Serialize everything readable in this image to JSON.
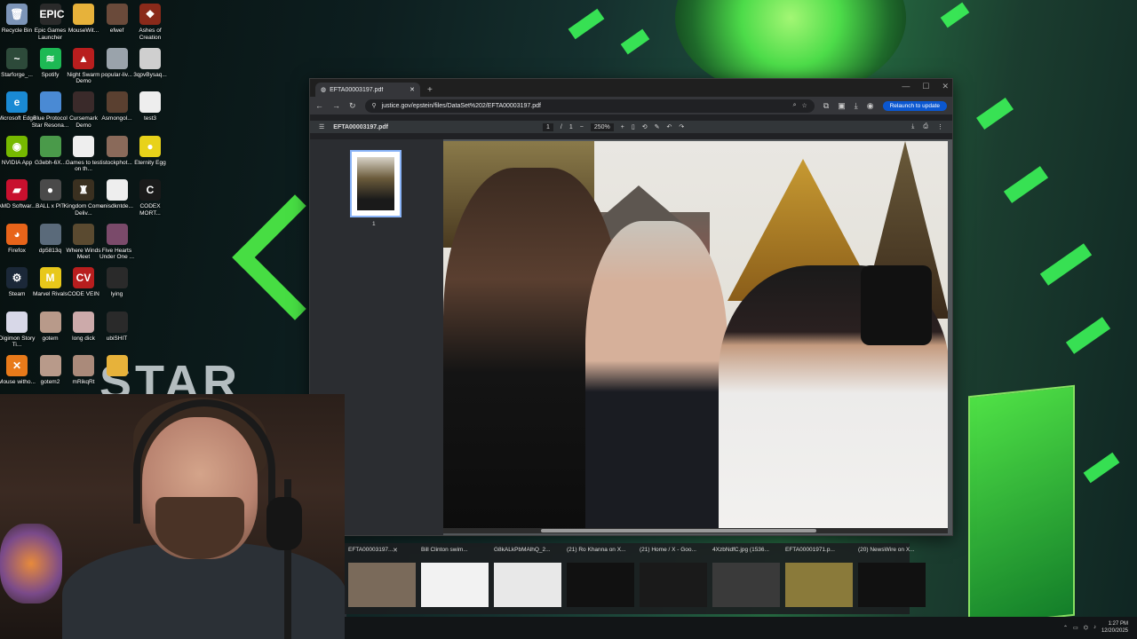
{
  "desktop": {
    "icons": [
      {
        "label": "Recycle Bin",
        "icon": "recycle-bin-icon",
        "color": "#7c95b8",
        "glyph": "🗑"
      },
      {
        "label": "Epic Games Launcher",
        "icon": "epic-games-icon",
        "color": "#2a2a2a",
        "glyph": "EPIC"
      },
      {
        "label": "MouseWit...",
        "icon": "folder-icon",
        "color": "#e7b23a",
        "glyph": ""
      },
      {
        "label": "efwef",
        "icon": "portrait-icon",
        "color": "#6a4a3a",
        "glyph": ""
      },
      {
        "label": "Ashes of Creation",
        "icon": "ashes-icon",
        "color": "#8a2a1a",
        "glyph": "❖"
      },
      {
        "label": "Starforge_...",
        "icon": "starforge-icon",
        "color": "#2d4a3a",
        "glyph": "~"
      },
      {
        "label": "Spotify",
        "icon": "spotify-icon",
        "color": "#1db954",
        "glyph": "≋"
      },
      {
        "label": "Night Swarm Demo",
        "icon": "night-swarm-icon",
        "color": "#b81e1e",
        "glyph": "▲"
      },
      {
        "label": "popular-liv...",
        "icon": "image-file-icon",
        "color": "#9aa3ab",
        "glyph": ""
      },
      {
        "label": "3qpvBysaq...",
        "icon": "image-file-icon",
        "color": "#cfcfcf",
        "glyph": ""
      },
      {
        "label": "Microsoft Edge",
        "icon": "edge-icon",
        "color": "#1a8ad4",
        "glyph": "e"
      },
      {
        "label": "Blue Protocol Star Resona...",
        "icon": "blue-protocol-icon",
        "color": "#4a8ad4",
        "glyph": ""
      },
      {
        "label": "Cursemark Demo",
        "icon": "cursemark-icon",
        "color": "#3a2a2a",
        "glyph": ""
      },
      {
        "label": "Asmongol...",
        "icon": "portrait-icon",
        "color": "#5a4030",
        "glyph": ""
      },
      {
        "label": "test3",
        "icon": "text-file-icon",
        "color": "#eeeeee",
        "glyph": ""
      },
      {
        "label": "NVIDIA App",
        "icon": "nvidia-icon",
        "color": "#76b900",
        "glyph": "◉"
      },
      {
        "label": "G3ebh-6X...",
        "icon": "image-file-icon",
        "color": "#4a9a4a",
        "glyph": ""
      },
      {
        "label": "Games to test on th...",
        "icon": "text-file-icon",
        "color": "#eeeeee",
        "glyph": ""
      },
      {
        "label": "istockphot...",
        "icon": "image-file-icon",
        "color": "#8a6a5a",
        "glyph": ""
      },
      {
        "label": "Eternity Egg",
        "icon": "eternity-egg-icon",
        "color": "#e8d21a",
        "glyph": "●"
      },
      {
        "label": "AMD Softwar...",
        "icon": "amd-icon",
        "color": "#c8102e",
        "glyph": "▰"
      },
      {
        "label": "BALL x PIT",
        "icon": "ball-pit-icon",
        "color": "#4a4a4a",
        "glyph": "●"
      },
      {
        "label": "Kingdom Come Deliv...",
        "icon": "kingdom-come-icon",
        "color": "#3a3020",
        "glyph": "♜"
      },
      {
        "label": "unisdkntde...",
        "icon": "text-file-icon",
        "color": "#eeeeee",
        "glyph": ""
      },
      {
        "label": "CODEX MORT...",
        "icon": "codex-icon",
        "color": "#1a1a1a",
        "glyph": "C"
      },
      {
        "label": "Firefox",
        "icon": "firefox-icon",
        "color": "#e8641a",
        "glyph": "◕"
      },
      {
        "label": "dp5813q",
        "icon": "image-file-icon",
        "color": "#5a6a7a",
        "glyph": ""
      },
      {
        "label": "Where Winds Meet",
        "icon": "where-winds-icon",
        "color": "#5a4a30",
        "glyph": ""
      },
      {
        "label": "Five Hearts Under One ...",
        "icon": "five-hearts-icon",
        "color": "#7a4a6a",
        "glyph": ""
      },
      {
        "label": "",
        "icon": "blank-icon",
        "color": "transparent",
        "glyph": ""
      },
      {
        "label": "Steam",
        "icon": "steam-icon",
        "color": "#1b2838",
        "glyph": "⚙"
      },
      {
        "label": "Marvel Rivals",
        "icon": "marvel-rivals-icon",
        "color": "#e8c81a",
        "glyph": "M"
      },
      {
        "label": "CODE VEIN",
        "icon": "code-vein-icon",
        "color": "#b81e1e",
        "glyph": "CV"
      },
      {
        "label": "lying",
        "icon": "image-file-icon",
        "color": "#2a2a2a",
        "glyph": ""
      },
      {
        "label": "",
        "icon": "blank-icon",
        "color": "transparent",
        "glyph": ""
      },
      {
        "label": "Digimon Story Ti...",
        "icon": "digimon-icon",
        "color": "#d8d8e8",
        "glyph": ""
      },
      {
        "label": "gotem",
        "icon": "image-file-icon",
        "color": "#b89a8a",
        "glyph": ""
      },
      {
        "label": "long dick",
        "icon": "image-file-icon",
        "color": "#caa",
        "glyph": ""
      },
      {
        "label": "ubiSHIT",
        "icon": "image-file-icon",
        "color": "#2a2a2a",
        "glyph": ""
      },
      {
        "label": "",
        "icon": "blank-icon",
        "color": "transparent",
        "glyph": ""
      },
      {
        "label": "Mouse witho...",
        "icon": "mouse-without-icon",
        "color": "#e87a1a",
        "glyph": "✕"
      },
      {
        "label": "gotem2",
        "icon": "image-file-icon",
        "color": "#b89a8a",
        "glyph": ""
      },
      {
        "label": "mRikqRt",
        "icon": "image-file-icon",
        "color": "#aa8a7a",
        "glyph": ""
      },
      {
        "label": "",
        "icon": "folder-icon",
        "color": "#e7b23a",
        "glyph": ""
      }
    ],
    "wallpaper_text": "STAR"
  },
  "browser": {
    "tab_title": "EFTA00003197.pdf",
    "new_tab": "+",
    "window_controls": [
      "—",
      "☐",
      "✕"
    ],
    "url": "justice.gov/epstein/files/DataSet%202/EFTA00003197.pdf",
    "relaunch_label": "Relaunch to update",
    "pdf": {
      "menu": "☰",
      "filename": "EFTA00003197.pdf",
      "page_current": "1",
      "page_sep": "/",
      "page_total": "1",
      "zoom": "250%",
      "zoom_out": "−",
      "zoom_in": "+",
      "thumb_number": "1"
    }
  },
  "previews": [
    {
      "title": "EFTA00003197...",
      "close": "✕"
    },
    {
      "title": "Bill Clinton swim..."
    },
    {
      "title": "G8kALkPbMAlhQ_2..."
    },
    {
      "title": "(21) Ro Khanna on X..."
    },
    {
      "title": "(21) Home / X - Goo..."
    },
    {
      "title": "4XzbNdfC.jpg (1536..."
    },
    {
      "title": "EFTA00001971.p..."
    },
    {
      "title": "(20) NewsWire on X..."
    }
  ],
  "taskbar": {
    "time": "1:27 PM",
    "date": "12/20/2025"
  }
}
